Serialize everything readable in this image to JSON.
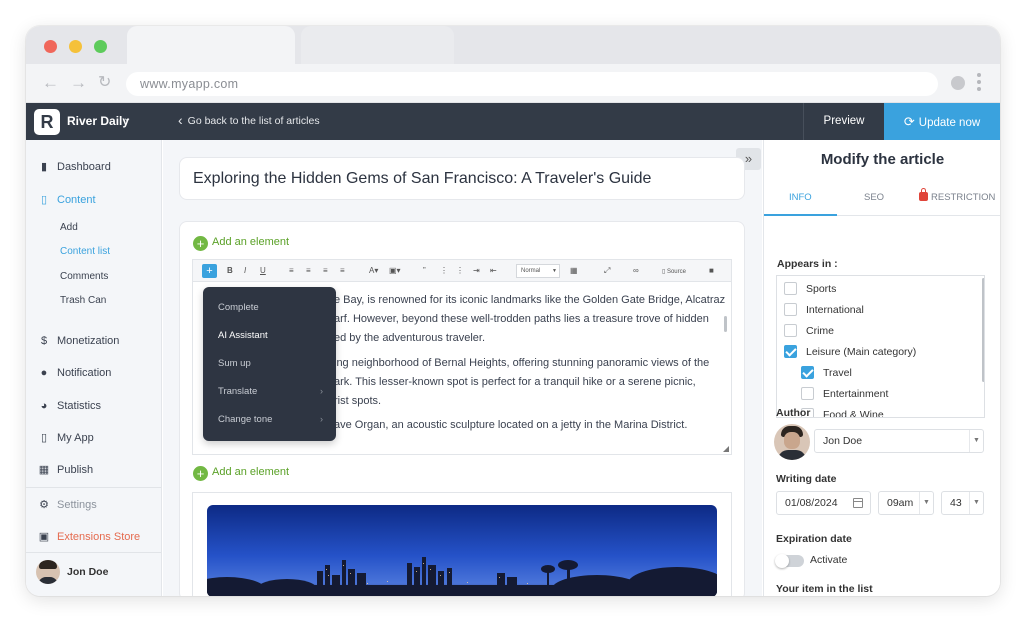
{
  "browser": {
    "url": "www.myapp.com"
  },
  "appbar": {
    "logo_letter": "R",
    "brand": "River Daily",
    "back_label": "Go back to the list of articles",
    "preview_label": "Preview",
    "update_label": "Update now"
  },
  "sidebar": {
    "items": [
      {
        "label": "Dashboard",
        "icon": "bar-chart-icon"
      },
      {
        "label": "Content",
        "icon": "document-icon"
      },
      {
        "label": "Monetization",
        "icon": "dollar-icon"
      },
      {
        "label": "Notification",
        "icon": "bell-icon"
      },
      {
        "label": "Statistics",
        "icon": "pie-chart-icon"
      },
      {
        "label": "My App",
        "icon": "phone-icon"
      },
      {
        "label": "Publish",
        "icon": "store-icon"
      },
      {
        "label": "Settings",
        "icon": "gear-icon"
      },
      {
        "label": "Extensions Store",
        "icon": "puzzle-icon"
      }
    ],
    "content_sub": [
      "Add",
      "Content list",
      "Comments",
      "Trash Can"
    ],
    "user_name": "Jon Doe"
  },
  "article": {
    "title": "Exploring the Hidden Gems of San Francisco: A Traveler's Guide",
    "add_element_label": "Add an element",
    "lines": [
      "e Bay, is renowned for its iconic landmarks like the Golden Gate Bridge, Alcatraz",
      "arf. However, beyond these well-trodden paths lies a treasure trove of hidden",
      "ed by the adventurous traveler.",
      "ing neighborhood of Bernal Heights, offering stunning panoramic views of the",
      "ark. This lesser-known spot is perfect for a tranquil hike or a serene picnic,",
      "rist spots.",
      "ave Organ, an acoustic sculpture located on a jetty in the Marina District."
    ],
    "toolbar": {
      "bold": "B",
      "italic": "I",
      "underline": "U",
      "paragraph_format": "Normal",
      "source_label": "Source"
    }
  },
  "ai_menu": {
    "items": [
      "Complete",
      "AI Assistant",
      "Sum up",
      "Translate",
      "Change tone"
    ]
  },
  "panel": {
    "title": "Modify the article",
    "tabs": [
      "INFO",
      "SEO",
      "RESTRICTION"
    ],
    "appears_in_label": "Appears in :",
    "categories": [
      {
        "label": "Sports",
        "checked": false
      },
      {
        "label": "International",
        "checked": false
      },
      {
        "label": "Crime",
        "checked": false
      },
      {
        "label": "Leisure (Main category)",
        "checked": true
      },
      {
        "label": "Travel",
        "checked": true
      },
      {
        "label": "Entertainment",
        "checked": false
      },
      {
        "label": "Food & Wine",
        "checked": false
      }
    ],
    "author_label": "Author",
    "author_value": "Jon Doe",
    "writing_date_label": "Writing date",
    "writing_date": "01/08/2024",
    "writing_hour": "09am",
    "writing_minute": "43",
    "expiration_label": "Expiration date",
    "activate_label": "Activate",
    "item_in_list_label": "Your item in the list"
  },
  "colors": {
    "accent": "#3aa2de",
    "appbar": "#333b47",
    "green": "#72b843",
    "extensions": "#e56b4f"
  }
}
